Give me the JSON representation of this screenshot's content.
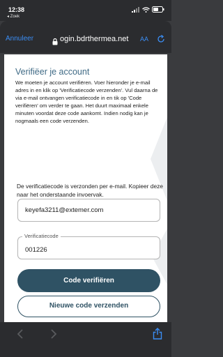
{
  "status_bar": {
    "time": "12:38",
    "back_app": "◂ Zoek"
  },
  "browser": {
    "cancel_label": "Annuleer",
    "domain": "ogin.bdrthermea.net",
    "text_size_label": "AA"
  },
  "page": {
    "title": "Verifiëer je account",
    "intro": "We moeten je account verifiëren. Voer hieronder je e-mail adres in en klik op 'Verificatiecode verzenden'. Vul daarna de via e-mail ontvangen verificatiecode in en tik op 'Code verifiëren' om verder te gaan. Het duurt maximaal enkele minuten voordat deze code aankomt. Indien nodig kan je nogmaals een code verzenden.",
    "notice": "De verificatiecode is verzonden per e-mail. Kopieer deze naar het onderstaande invoervak.",
    "email": {
      "value": "keyefa3211@extemer.com"
    },
    "code": {
      "label": "Verificatiecode",
      "value": "001226"
    },
    "verify_button": "Code verifiëren",
    "resend_button": "Nieuwe code verzenden"
  },
  "icons": {
    "status": [
      "signal-icon",
      "wifi-icon",
      "battery-icon"
    ],
    "browser": [
      "lock-icon",
      "reload-icon"
    ],
    "toolbar": [
      "back-arrow-icon",
      "forward-arrow-icon",
      "share-icon"
    ]
  },
  "colors": {
    "accent": "#3b8ef5",
    "primary_button": "#2f5264",
    "title": "#3f6a85",
    "chrome": "#2b2c2f"
  }
}
